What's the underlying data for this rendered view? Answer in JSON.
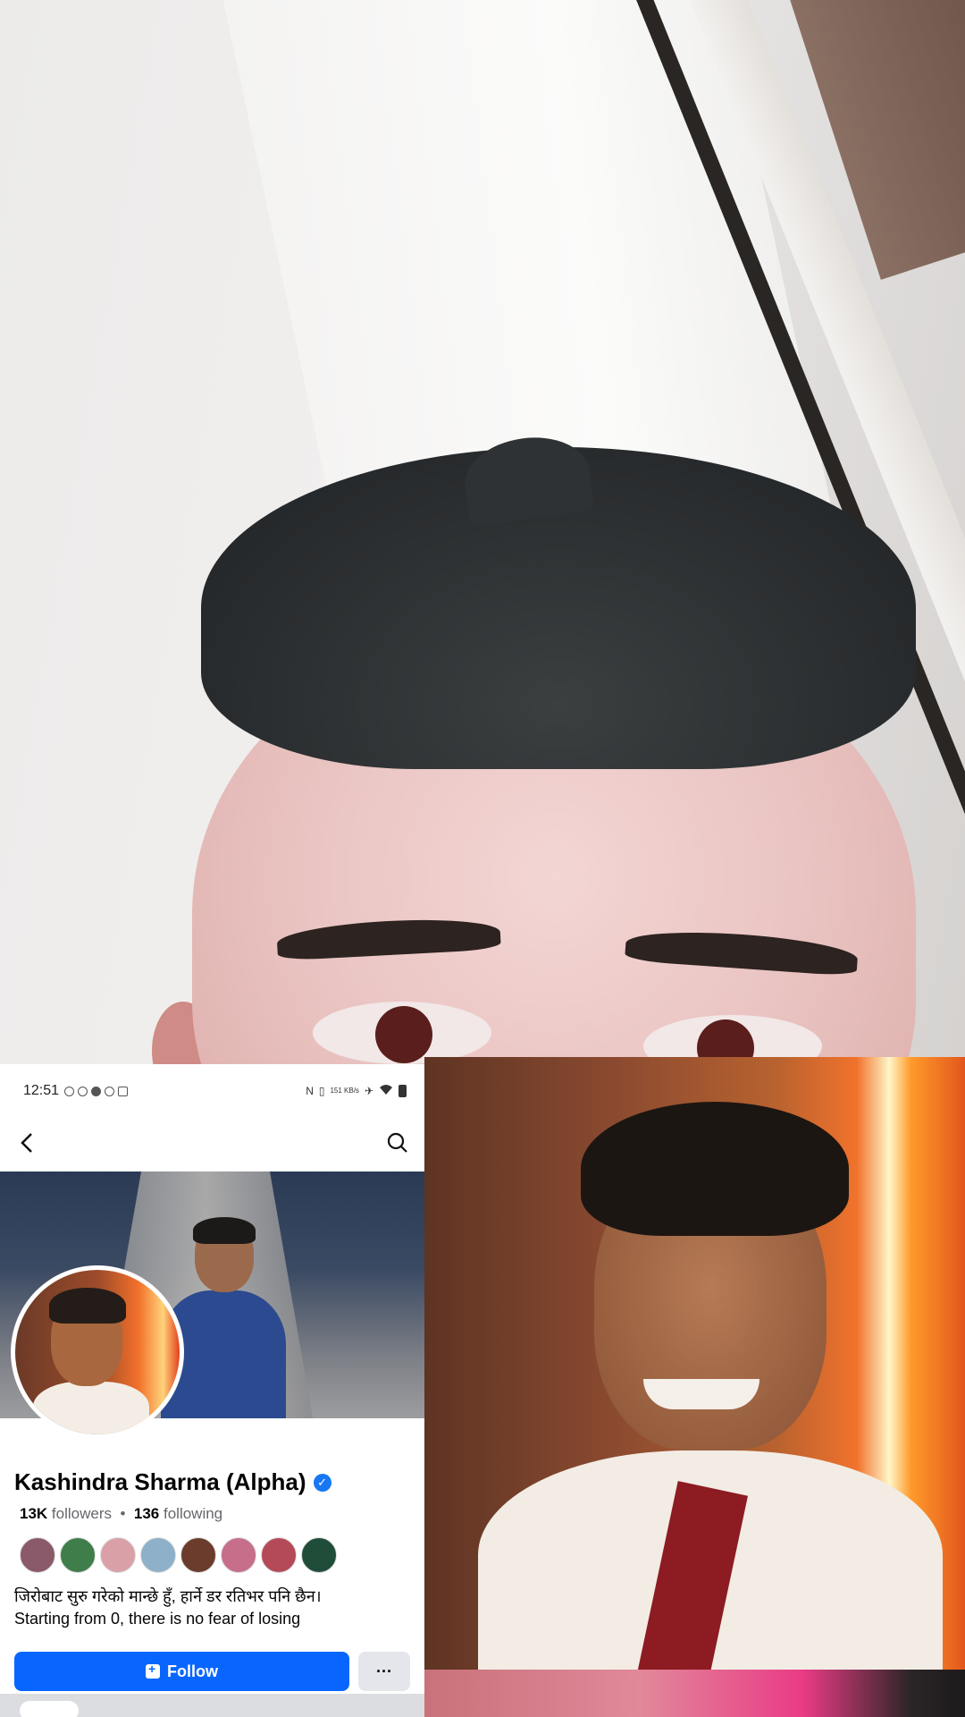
{
  "status_bar": {
    "time": "12:51",
    "left_icons": [
      "whatsapp-icon",
      "messenger-icon",
      "facebook-icon",
      "key-icon",
      "screen-icon"
    ],
    "network_speed": "151 KB/s",
    "right_icons": [
      "nfc-icon",
      "vibrate-icon",
      "airplane-icon",
      "wifi-icon",
      "battery-icon"
    ]
  },
  "nav": {
    "back_icon": "back-arrow-icon",
    "search_icon": "search-icon"
  },
  "profile": {
    "name": "Kashindra Sharma (Alpha)",
    "verified": true,
    "followers_count": "13K",
    "followers_label": "followers",
    "separator": "•",
    "following_count": "136",
    "following_label": "following",
    "bio_line1": "जिरोबाट सुरु गरेको मान्छे हुँ, हार्ने डर रतिभर पनि छैन।",
    "bio_line2": "Starting from 0, there is no fear of losing",
    "follow_label": "Follow",
    "more_label": "···"
  },
  "friend_avatar_colors": [
    "#8a5a6a",
    "#3f7d4a",
    "#d9a0a8",
    "#8fb0c9",
    "#6b3c2c",
    "#c76f8a",
    "#b44a58",
    "#1f4d3a"
  ],
  "colors": {
    "brand_blue": "#0866ff",
    "verified_blue": "#1877f2",
    "text_primary": "#050505",
    "text_secondary": "#65676b"
  }
}
